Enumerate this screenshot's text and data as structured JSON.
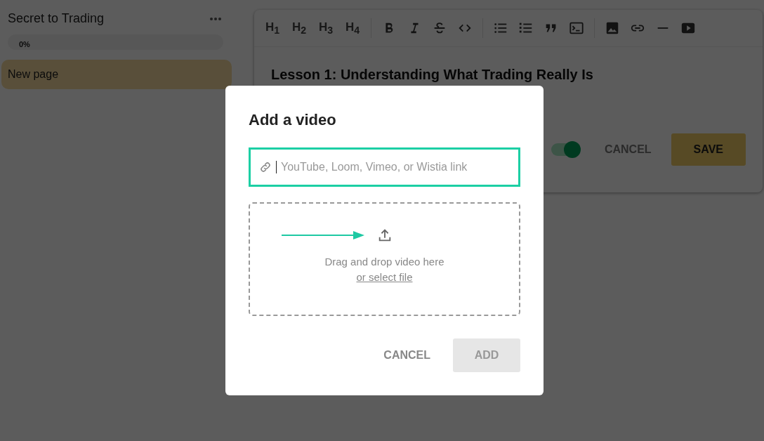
{
  "sidebar": {
    "title": "Secret to Trading",
    "progress": {
      "level": 0,
      "reading": "0%"
    },
    "pages": [
      {
        "label": "New page",
        "selected": true
      }
    ]
  },
  "editor": {
    "headings": [
      "H$_{1}$",
      "H$_{2}$",
      "H$_{3}$",
      "H$_{4}$"
    ],
    "lesson_title": "Lesson 1: Understanding What Trading Really Is",
    "toggle": {
      "on": true
    },
    "cancel": "CANCEL",
    "save": "SAVE"
  },
  "dialog": {
    "title": "Add a video",
    "link_field": {
      "placeholder": "YouTube, Loom, Vimeo, or Wistia link",
      "focused": true
    },
    "dropzone": {
      "text": "Drag and drop video here",
      "link": "or select file"
    },
    "cancel": "CANCEL",
    "add": {
      "label": "ADD",
      "disabled": true
    }
  }
}
